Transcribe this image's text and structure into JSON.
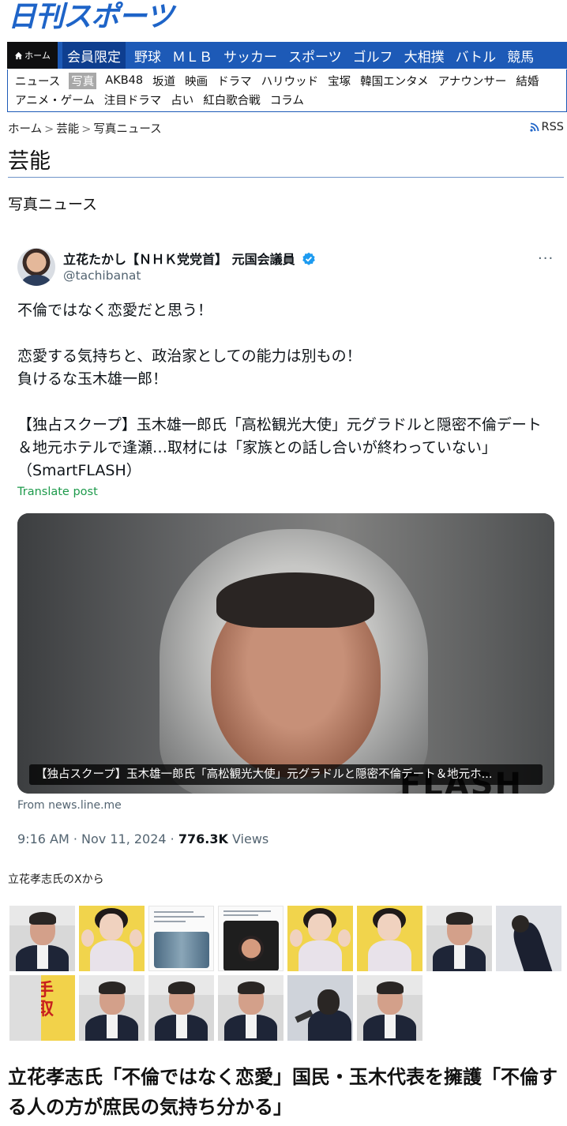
{
  "site": {
    "logo": "日刊スポーツ",
    "brand_color": "#1e64c8"
  },
  "nav_primary": {
    "home_label": "ホーム",
    "items": [
      "会員限定",
      "野球",
      "ＭＬＢ",
      "サッカー",
      "スポーツ",
      "ゴルフ",
      "大相撲",
      "バトル",
      "競馬"
    ]
  },
  "nav_secondary": {
    "row1": [
      "ニュース",
      "写真",
      "AKB48",
      "坂道",
      "映画",
      "ドラマ",
      "ハリウッド",
      "宝塚",
      "韓国エンタメ",
      "アナウンサー",
      "結婚"
    ],
    "row2": [
      "アニメ・ゲーム",
      "注目ドラマ",
      "占い",
      "紅白歌合戦",
      "コラム"
    ],
    "active": "写真"
  },
  "breadcrumb": {
    "items": [
      "ホーム",
      "芸能",
      "写真ニュース"
    ],
    "rss_label": "RSS"
  },
  "section": {
    "title": "芸能",
    "subtitle": "写真ニュース"
  },
  "tweet": {
    "display_name": "立花たかし【ＮＨＫ党党首】 元国会議員",
    "handle": "@tachibanat",
    "more_label": "···",
    "body": [
      "不倫ではなく恋愛だと思う！",
      "",
      "恋愛する気持ちと、政治家としての能力は別もの！",
      "負けるな玉木雄一郎！",
      "",
      "【独占スクープ】玉木雄一郎氏「高松観光大使」元グラドルと隠密不倫デート＆地元ホテルで逢瀬…取材には「家族との話し合いが終わっていない」（SmartFLASH）"
    ],
    "translate_label": "Translate post",
    "card_caption": "【独占スクープ】玉木雄一郎氏「高松観光大使」元グラドルと隠密不倫デート＆地元ホ...",
    "card_watermark": "FLASH",
    "from_label": "From news.line.me",
    "time": "9:16 AM · Nov 11, 2024 · ",
    "views_count": "776.3K",
    "views_label": " Views"
  },
  "photo_source": "立花孝志氏のXから",
  "thumbnails": [
    {
      "kind": "man"
    },
    {
      "kind": "woman"
    },
    {
      "kind": "shot"
    },
    {
      "kind": "shot2"
    },
    {
      "kind": "woman"
    },
    {
      "kind": "woman"
    },
    {
      "kind": "man"
    },
    {
      "kind": "bow"
    },
    {
      "kind": "sign",
      "text": "手取"
    },
    {
      "kind": "man"
    },
    {
      "kind": "man"
    },
    {
      "kind": "man"
    },
    {
      "kind": "press"
    },
    {
      "kind": "man"
    }
  ],
  "headline": "立花孝志氏「不倫ではなく恋愛」国民・玉木代表を擁護「不倫する人の方が庶民の気持ち分かる」"
}
